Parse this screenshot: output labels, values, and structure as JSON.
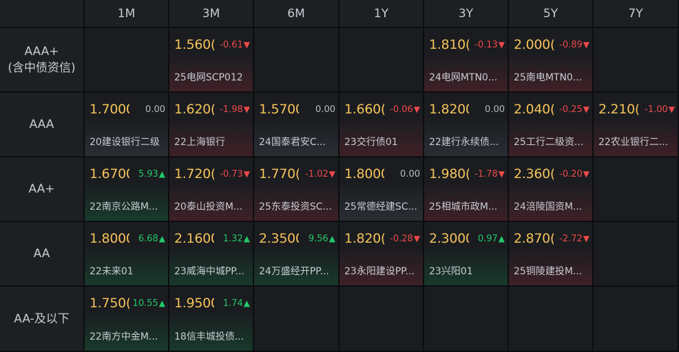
{
  "columns": [
    "1M",
    "3M",
    "6M",
    "1Y",
    "3Y",
    "5Y",
    "7Y"
  ],
  "rows": [
    {
      "label": "AAA+\n(含中债资信)",
      "cells": [
        null,
        {
          "yield": "1.560(",
          "change": "-0.61",
          "trend": "down",
          "name": "25电网SCP012"
        },
        null,
        null,
        {
          "yield": "1.810(",
          "change": "-0.13",
          "trend": "down",
          "name": "24电网MTN0..."
        },
        {
          "yield": "2.000(",
          "change": "-0.89",
          "trend": "down",
          "name": "25南电MTN0..."
        },
        null
      ]
    },
    {
      "label": "AAA",
      "cells": [
        {
          "yield": "1.7000",
          "change": "0.00",
          "trend": "flat",
          "name": "20建设银行二级"
        },
        {
          "yield": "1.620(",
          "change": "-1.98",
          "trend": "down",
          "name": "22上海银行"
        },
        {
          "yield": "1.5700",
          "change": "0.00",
          "trend": "flat",
          "name": "24国泰君安C..."
        },
        {
          "yield": "1.660(",
          "change": "-0.06",
          "trend": "down",
          "name": "23交行债01"
        },
        {
          "yield": "1.8200",
          "change": "0.00",
          "trend": "flat",
          "name": "22建行永续债..."
        },
        {
          "yield": "2.040(",
          "change": "-0.25",
          "trend": "down",
          "name": "25工行二级资..."
        },
        {
          "yield": "2.210(",
          "change": "-1.00",
          "trend": "down",
          "name": "22农业银行二..."
        }
      ]
    },
    {
      "label": "AA+",
      "cells": [
        {
          "yield": "1.6700",
          "change": "5.93",
          "trend": "up",
          "name": "22南京公路M..."
        },
        {
          "yield": "1.720(",
          "change": "-0.73",
          "trend": "down",
          "name": "20泰山投资M..."
        },
        {
          "yield": "1.770(",
          "change": "-1.02",
          "trend": "down",
          "name": "25东泰投资SC..."
        },
        {
          "yield": "1.8000",
          "change": "0.00",
          "trend": "flat",
          "name": "25常德经建SC..."
        },
        {
          "yield": "1.980(",
          "change": "-1.78",
          "trend": "down",
          "name": "25相城市政M..."
        },
        {
          "yield": "2.360(",
          "change": "-0.20",
          "trend": "down",
          "name": "24涪陵国资M..."
        },
        null
      ]
    },
    {
      "label": "AA",
      "cells": [
        {
          "yield": "1.8000",
          "change": "6.68",
          "trend": "up",
          "name": "22未来01"
        },
        {
          "yield": "2.1600",
          "change": "1.32",
          "trend": "up",
          "name": "23威海中城PP..."
        },
        {
          "yield": "2.3500",
          "change": "9.56",
          "trend": "up",
          "name": "24万盛经开PP..."
        },
        {
          "yield": "1.820(",
          "change": "-0.28",
          "trend": "down",
          "name": "23永阳建设PP..."
        },
        {
          "yield": "2.3000",
          "change": "0.97",
          "trend": "up",
          "name": "23兴阳01"
        },
        {
          "yield": "2.870(",
          "change": "-2.72",
          "trend": "down",
          "name": "25铜陵建投M..."
        },
        null
      ]
    },
    {
      "label": "AA-及以下",
      "cells": [
        {
          "yield": "1.750(",
          "change": "10.55",
          "trend": "up",
          "name": "22南方中金M..."
        },
        {
          "yield": "1.9500",
          "change": "1.74",
          "trend": "up",
          "name": "18信丰城投债..."
        },
        null,
        null,
        null,
        null,
        null
      ]
    }
  ],
  "colors": {
    "yield": "#f6c35a",
    "up": "#23c969",
    "down": "#ef4a4a",
    "flat": "#b8bcc2",
    "header_bg": "#1d1f23",
    "cell_bg": "#1a1c20"
  },
  "icons": {
    "up": "triangle-up-icon",
    "down": "triangle-down-icon"
  }
}
